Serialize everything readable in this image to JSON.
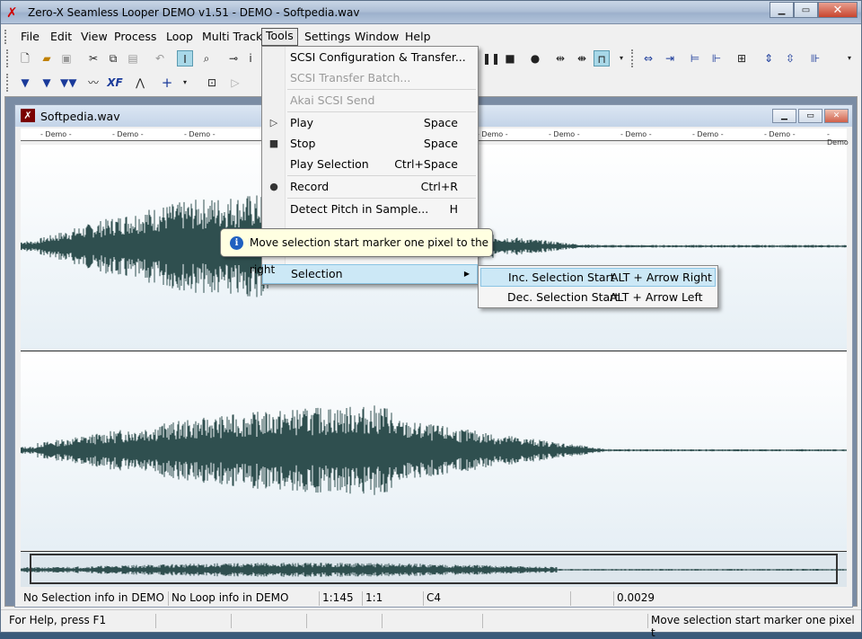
{
  "window": {
    "title": "Zero-X Seamless Looper   DEMO v1.51 - DEMO - Softpedia.wav",
    "minimize": "▁",
    "maximize": "▭",
    "close": "✕"
  },
  "menubar": [
    "File",
    "Edit",
    "View",
    "Process",
    "Loop",
    "Multi Track",
    "Tools",
    "Settings",
    "Window",
    "Help"
  ],
  "toolbar_icons": [
    "new-file",
    "open-folder",
    "save",
    "cut",
    "copy",
    "paste",
    "undo",
    "selection-tool",
    "zoom-tool",
    "key",
    "info",
    "pause",
    "stop",
    "record",
    "loop-shrink",
    "loop-expand",
    "snap",
    "arrow-left-right",
    "arrow-collapse",
    "marker-span",
    "marker-split",
    "crop",
    "arrow-up-down",
    "arrow-vertical-expand",
    "marker-loop",
    "marker-down",
    "marker-down-2",
    "marker-down-3",
    "wave",
    "crossfade",
    "mountains",
    "plus",
    "record-box",
    "play-step"
  ],
  "toolbar_text": {
    "crossfade": "XF",
    "plus": "+"
  },
  "child": {
    "title": "Softpedia.wav",
    "ruler_label": "- Demo -"
  },
  "tools_menu": {
    "items": [
      {
        "label": "SCSI Configuration & Transfer...",
        "shortcut": "",
        "disabled": false
      },
      {
        "label": "SCSI Transfer Batch...",
        "shortcut": "",
        "disabled": true
      },
      {
        "label": "Akai SCSI Send",
        "shortcut": "",
        "disabled": true
      },
      {
        "label": "Play",
        "shortcut": "Space",
        "disabled": false
      },
      {
        "label": "Stop",
        "shortcut": "Space",
        "disabled": false
      },
      {
        "label": "Play Selection",
        "shortcut": "Ctrl+Space",
        "disabled": false
      },
      {
        "label": "Record",
        "shortcut": "Ctrl+R",
        "disabled": false
      },
      {
        "label": "Detect Pitch in Sample...",
        "shortcut": "H",
        "disabled": false
      },
      {
        "label": "Selection",
        "shortcut": "",
        "disabled": false
      }
    ]
  },
  "selection_submenu": [
    {
      "label": "Inc. Selection Start",
      "shortcut": "ALT + Arrow Right"
    },
    {
      "label": "Dec. Selection Start",
      "shortcut": "ALT + Arrow Left"
    }
  ],
  "tooltip": "Move selection start marker one pixel to the right",
  "status_inner": [
    "No Selection info in DEMO",
    "No Loop info in DEMO",
    "1:145",
    "1:1",
    "C4",
    "",
    "0.0029"
  ],
  "status_outer": {
    "help": "For Help, press F1",
    "message": "Move selection start marker one pixel t"
  },
  "colors": {
    "waveform": "#2f4f4f",
    "menu_highlight": "#cce8f6",
    "tooltip_bg": "#ffffe1"
  }
}
